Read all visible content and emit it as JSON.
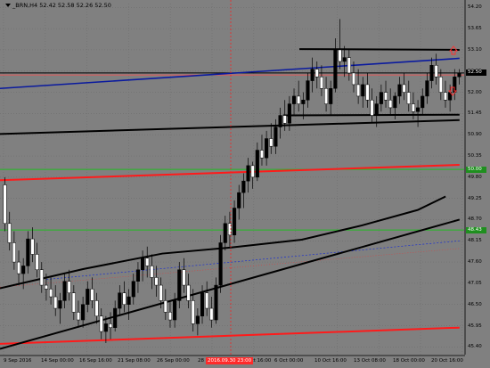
{
  "header": {
    "symbol_line": "_BRN,H4  52.42  52.58  52.26  52.50"
  },
  "y_axis": {
    "ticks": [
      "54.20",
      "53.65",
      "53.10",
      "52.55",
      "52.00",
      "51.45",
      "50.90",
      "50.35",
      "49.80",
      "49.25",
      "48.70",
      "48.15",
      "47.60",
      "47.05",
      "46.50",
      "45.95",
      "45.40"
    ],
    "tags": [
      {
        "label": "52.50",
        "value": 52.5,
        "color": "#000000"
      },
      {
        "label": "50.00",
        "value": 50.0,
        "color": "#1f8f1f"
      },
      {
        "label": "48.43",
        "value": 48.43,
        "color": "#1f8f1f"
      }
    ]
  },
  "x_axis": {
    "ticks": [
      "9 Sep 2016",
      "14 Sep 00:00",
      "16 Sep 16:00",
      "21 Sep 08:00",
      "26 Sep 00:00",
      "28",
      "4 Oct 16:00",
      "6 Oct 00:00",
      "10 Oct 16:00",
      "13 Oct 08:00",
      "18 Oct 00:00",
      "20 Oct 16:00"
    ],
    "crosshair_label": "2016.09.30 23:00"
  },
  "colors": {
    "background": "#808080",
    "bull": "#000000",
    "bear": "#ffffff",
    "red": "#ff1a1a",
    "green": "#22bb22",
    "blue": "#0a1a9e",
    "grid": "#6e6e6e"
  },
  "chart_data": {
    "type": "candlestick",
    "symbol": "_BRN",
    "timeframe": "H4",
    "ylim": [
      45.2,
      54.3
    ],
    "ohlc": [
      [
        49.6,
        49.8,
        48.4,
        48.6
      ],
      [
        48.6,
        48.9,
        47.9,
        48.1
      ],
      [
        48.1,
        48.4,
        47.4,
        47.6
      ],
      [
        47.6,
        47.9,
        47.0,
        47.3
      ],
      [
        47.3,
        47.7,
        46.9,
        47.5
      ],
      [
        47.5,
        48.4,
        47.3,
        48.2
      ],
      [
        48.2,
        48.5,
        47.6,
        47.8
      ],
      [
        47.8,
        48.1,
        47.2,
        47.4
      ],
      [
        47.4,
        47.6,
        46.8,
        47.0
      ],
      [
        47.0,
        47.3,
        46.6,
        46.9
      ],
      [
        46.9,
        47.2,
        46.5,
        46.7
      ],
      [
        46.7,
        47.0,
        46.2,
        46.4
      ],
      [
        46.4,
        46.8,
        46.0,
        46.6
      ],
      [
        46.6,
        47.3,
        46.4,
        47.1
      ],
      [
        47.1,
        47.4,
        46.6,
        46.8
      ],
      [
        46.8,
        47.0,
        46.1,
        46.3
      ],
      [
        46.3,
        46.6,
        45.9,
        46.1
      ],
      [
        46.1,
        46.7,
        45.9,
        46.5
      ],
      [
        46.5,
        47.1,
        46.3,
        46.9
      ],
      [
        46.9,
        47.2,
        46.4,
        46.6
      ],
      [
        46.6,
        46.8,
        46.0,
        46.2
      ],
      [
        46.2,
        46.4,
        45.6,
        45.8
      ],
      [
        45.8,
        46.2,
        45.5,
        46.0
      ],
      [
        46.0,
        46.3,
        45.6,
        45.9
      ],
      [
        45.9,
        46.6,
        45.8,
        46.4
      ],
      [
        46.4,
        47.0,
        46.2,
        46.8
      ],
      [
        46.8,
        47.1,
        46.3,
        46.5
      ],
      [
        46.5,
        46.9,
        46.1,
        46.7
      ],
      [
        46.7,
        47.3,
        46.5,
        47.1
      ],
      [
        47.1,
        47.6,
        46.8,
        47.4
      ],
      [
        47.4,
        47.9,
        47.1,
        47.7
      ],
      [
        47.7,
        48.0,
        47.2,
        47.5
      ],
      [
        47.5,
        47.8,
        46.9,
        47.2
      ],
      [
        47.2,
        47.5,
        46.7,
        47.0
      ],
      [
        47.0,
        47.2,
        46.4,
        46.6
      ],
      [
        46.6,
        46.9,
        46.1,
        46.3
      ],
      [
        46.3,
        46.6,
        45.9,
        46.1
      ],
      [
        46.1,
        46.8,
        45.9,
        46.6
      ],
      [
        46.6,
        47.6,
        46.4,
        47.4
      ],
      [
        47.4,
        47.7,
        46.8,
        47.0
      ],
      [
        47.0,
        47.3,
        46.4,
        46.6
      ],
      [
        46.6,
        46.9,
        45.8,
        46.0
      ],
      [
        46.0,
        46.4,
        45.7,
        46.2
      ],
      [
        46.2,
        47.0,
        46.0,
        46.8
      ],
      [
        46.8,
        47.1,
        46.2,
        46.4
      ],
      [
        46.4,
        46.7,
        45.9,
        46.1
      ],
      [
        46.1,
        47.2,
        46.0,
        47.0
      ],
      [
        47.0,
        48.3,
        46.8,
        48.1
      ],
      [
        48.1,
        48.8,
        47.9,
        48.6
      ],
      [
        48.6,
        48.9,
        48.0,
        48.3
      ],
      [
        48.3,
        49.2,
        48.1,
        49.0
      ],
      [
        49.0,
        49.6,
        48.7,
        49.4
      ],
      [
        49.4,
        49.9,
        49.0,
        49.7
      ],
      [
        49.7,
        50.3,
        49.4,
        50.1
      ],
      [
        50.1,
        50.2,
        49.5,
        49.8
      ],
      [
        49.8,
        50.7,
        49.7,
        50.5
      ],
      [
        50.5,
        50.9,
        50.1,
        50.3
      ],
      [
        50.3,
        51.0,
        50.1,
        50.8
      ],
      [
        50.8,
        51.2,
        50.4,
        50.6
      ],
      [
        50.6,
        51.3,
        50.4,
        51.1
      ],
      [
        51.1,
        51.6,
        50.8,
        51.4
      ],
      [
        51.4,
        51.8,
        51.0,
        51.2
      ],
      [
        51.2,
        51.9,
        51.0,
        51.7
      ],
      [
        51.7,
        52.1,
        51.4,
        51.9
      ],
      [
        51.9,
        52.3,
        51.5,
        51.7
      ],
      [
        51.7,
        52.0,
        51.3,
        51.8
      ],
      [
        51.8,
        52.5,
        51.6,
        52.3
      ],
      [
        52.3,
        52.9,
        52.0,
        52.6
      ],
      [
        52.6,
        52.8,
        52.1,
        52.4
      ],
      [
        52.4,
        52.7,
        51.9,
        52.1
      ],
      [
        52.1,
        52.4,
        51.5,
        51.7
      ],
      [
        51.7,
        52.3,
        51.4,
        52.1
      ],
      [
        52.1,
        53.4,
        52.0,
        53.1
      ],
      [
        53.1,
        53.9,
        52.6,
        52.8
      ],
      [
        52.8,
        53.2,
        52.4,
        52.9
      ],
      [
        52.9,
        53.1,
        52.3,
        52.5
      ],
      [
        52.5,
        52.8,
        52.0,
        52.2
      ],
      [
        52.2,
        52.6,
        51.7,
        51.9
      ],
      [
        51.9,
        52.4,
        51.6,
        52.2
      ],
      [
        52.2,
        52.5,
        51.6,
        51.8
      ],
      [
        51.8,
        52.1,
        51.2,
        51.4
      ],
      [
        51.4,
        51.9,
        51.1,
        51.7
      ],
      [
        51.7,
        52.2,
        51.5,
        52.0
      ],
      [
        52.0,
        52.3,
        51.6,
        51.8
      ],
      [
        51.8,
        52.1,
        51.4,
        51.6
      ],
      [
        51.6,
        52.0,
        51.3,
        51.9
      ],
      [
        51.9,
        52.4,
        51.7,
        52.2
      ],
      [
        52.2,
        52.5,
        51.8,
        52.0
      ],
      [
        52.0,
        52.3,
        51.5,
        51.7
      ],
      [
        51.7,
        52.0,
        51.3,
        51.5
      ],
      [
        51.5,
        51.8,
        51.1,
        51.6
      ],
      [
        51.6,
        52.1,
        51.4,
        51.9
      ],
      [
        51.9,
        52.5,
        51.7,
        52.3
      ],
      [
        52.3,
        52.9,
        52.1,
        52.7
      ],
      [
        52.7,
        53.0,
        52.2,
        52.4
      ],
      [
        52.4,
        52.6,
        51.8,
        52.0
      ],
      [
        52.0,
        52.3,
        51.6,
        51.8
      ],
      [
        51.8,
        52.2,
        51.5,
        52.0
      ],
      [
        52.0,
        52.6,
        51.8,
        52.4
      ],
      [
        52.4,
        52.6,
        52.2,
        52.5
      ]
    ],
    "hlines": [
      {
        "value": 52.5,
        "color": "#000000"
      },
      {
        "value": 50.0,
        "color": "#22bb22"
      },
      {
        "value": 48.43,
        "color": "#22bb22"
      },
      {
        "value": 52.45,
        "color": "#ff4a4a"
      }
    ],
    "trendlines": [
      {
        "name": "channel-top",
        "color": "#000000",
        "points": [
          [
            0.645,
            53.12
          ],
          [
            0.99,
            53.1
          ]
        ]
      },
      {
        "name": "channel-bottom",
        "color": "#000000",
        "points": [
          [
            0.61,
            51.4
          ],
          [
            0.99,
            51.42
          ]
        ]
      },
      {
        "name": "blue-resistance",
        "color": "#0a1a9e",
        "points": [
          [
            0.0,
            52.1
          ],
          [
            0.99,
            52.88
          ]
        ]
      },
      {
        "name": "black-support-upper",
        "color": "#000000",
        "points": [
          [
            0.0,
            50.92
          ],
          [
            0.99,
            51.28
          ]
        ]
      },
      {
        "name": "red-mid",
        "color": "#ff1a1a",
        "points": [
          [
            0.0,
            49.72
          ],
          [
            0.99,
            50.12
          ]
        ]
      },
      {
        "name": "red-low",
        "color": "#ff1a1a",
        "points": [
          [
            0.0,
            45.48
          ],
          [
            0.99,
            45.9
          ]
        ]
      },
      {
        "name": "black-uptrend",
        "color": "#000000",
        "points": [
          [
            0.0,
            45.35
          ],
          [
            0.99,
            48.7
          ]
        ]
      },
      {
        "name": "moving-average",
        "color": "#000000",
        "points": [
          [
            0.0,
            46.92
          ],
          [
            0.18,
            47.42
          ],
          [
            0.35,
            47.82
          ],
          [
            0.5,
            47.98
          ],
          [
            0.65,
            48.18
          ],
          [
            0.78,
            48.55
          ],
          [
            0.9,
            48.95
          ],
          [
            0.96,
            49.3
          ]
        ]
      }
    ],
    "vline": {
      "label": "2016.09.30 23:00",
      "color": "#ff1a1a"
    }
  }
}
